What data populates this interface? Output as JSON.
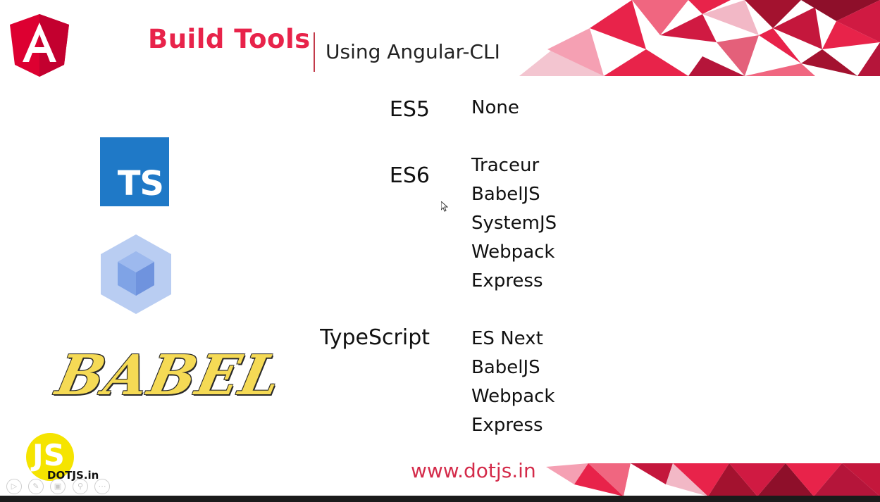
{
  "slide": {
    "title": "Build Tools",
    "subtitle": "Using Angular-CLI",
    "website": "www.dotjs.in",
    "brand": "DOTJS.in",
    "brand_mark": "JS",
    "ts_mark": "TS",
    "babel_mark": "BABEL"
  },
  "table": {
    "es5": {
      "label": "ES5",
      "tools": [
        "None"
      ]
    },
    "es6": {
      "label": "ES6",
      "tools": [
        "Traceur",
        "BabelJS",
        "SystemJS",
        "Webpack",
        "Express"
      ]
    },
    "typescript": {
      "label": "TypeScript",
      "tools": [
        "ES Next",
        "BabelJS",
        "Webpack",
        "Express"
      ]
    }
  },
  "icons": {
    "angular": "angular-logo-icon",
    "typescript": "typescript-logo-icon",
    "webpack": "webpack-logo-icon",
    "babel": "babel-logo-icon"
  },
  "colors": {
    "accent": "#e8234a",
    "typescript_blue": "#1f79c7",
    "webpack_blue": "#8ed6fb",
    "babel_yellow": "#f5da55",
    "dotjs_yellow": "#f5e400"
  }
}
